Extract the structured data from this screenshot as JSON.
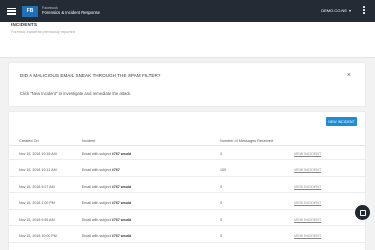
{
  "header": {
    "logo": "FB",
    "brand_line1": "Facebook",
    "brand_line2": "Forensics & Incident Response",
    "user": "DEMO.CO.NE",
    "user_caret": "▾"
  },
  "page": {
    "title": "INCIDENTS",
    "subtitle": "Forensic incidents previously reported"
  },
  "promo": {
    "title": "DID A MALICIOUS EMAIL SNEAK THROUGH THE SPAM FILTER?",
    "text": "Click \"New Incident\" to investigate and remediate the attack",
    "close": "×"
  },
  "table": {
    "new_button": "NEW INCIDENT",
    "columns": [
      "Created On",
      "Incident",
      "Number of Messages Received",
      ""
    ],
    "rows": [
      {
        "created": "Nov 15, 2018 10:16 AM",
        "prefix": "Email with subject ",
        "subject": "#767 would",
        "count": "3",
        "action": "VIEW INCIDENT"
      },
      {
        "created": "Nov 15, 2018 10:12 AM",
        "prefix": "Email with subject ",
        "subject": "#767",
        "count": "100",
        "action": "VIEW INCIDENT"
      },
      {
        "created": "Nov 15, 2018 9:27 AM",
        "prefix": "Email with subject ",
        "subject": "#767 would",
        "count": "3",
        "action": "VIEW INCIDENT"
      },
      {
        "created": "Nov 15, 2018 1:00 PM",
        "prefix": "Email with subject ",
        "subject": "#767 would",
        "count": "3",
        "action": "VIEW INCIDENT"
      },
      {
        "created": "Nov 15, 2018 9:55 AM",
        "prefix": "Email with subject ",
        "subject": "#767 would",
        "count": "3",
        "action": "VIEW INCIDENT"
      },
      {
        "created": "Nov 15, 2018 10:00 PM",
        "prefix": "Email with subject ",
        "subject": "#767 would",
        "count": "3",
        "action": "VIEW INCIDENT"
      }
    ]
  },
  "icons": {
    "menu": "menu-icon",
    "kebab": "more-vertical-icon",
    "close": "close-icon",
    "chat": "chat-icon"
  },
  "colors": {
    "topbar": "#232c35",
    "accent": "#1c8bd8",
    "background": "#f2f2f2"
  }
}
